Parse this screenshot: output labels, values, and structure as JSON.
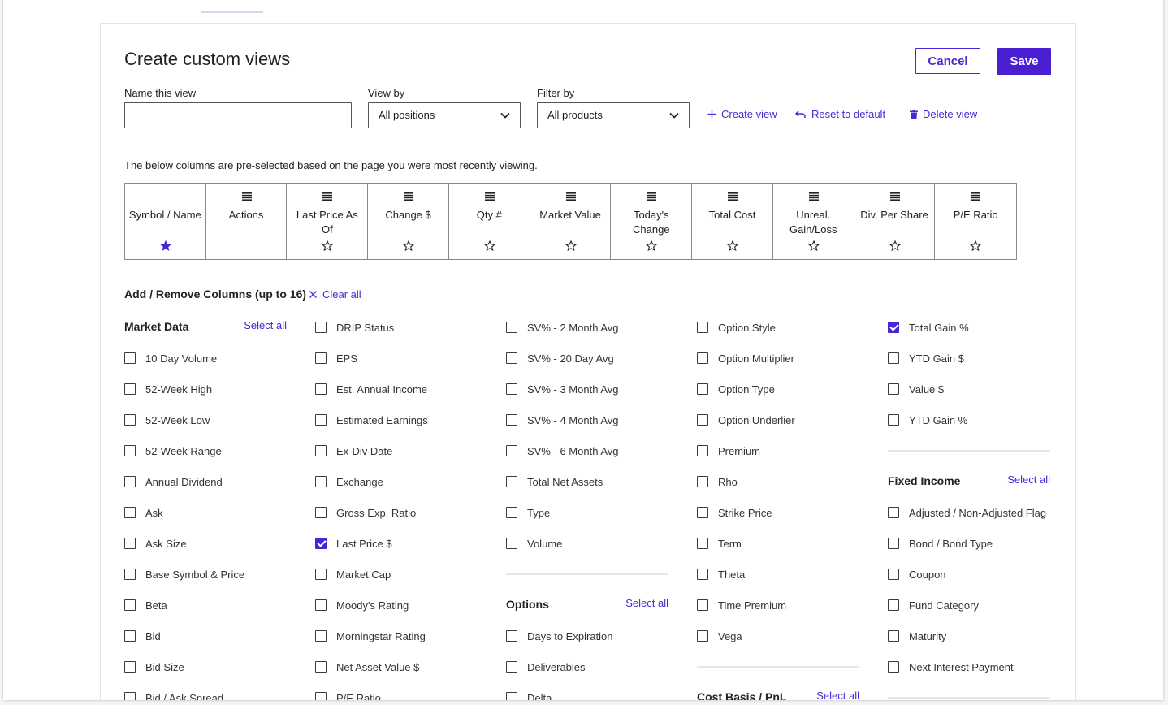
{
  "header": {
    "title": "Create custom views",
    "cancel_label": "Cancel",
    "save_label": "Save"
  },
  "form": {
    "name_label": "Name this view",
    "name_value": "",
    "viewby_label": "View by",
    "viewby_value": "All positions",
    "filterby_label": "Filter by",
    "filterby_value": "All products"
  },
  "actions": {
    "create": "Create view",
    "reset": "Reset to default",
    "delete": "Delete view"
  },
  "note": "The below columns are pre-selected based on the page you were most recently viewing.",
  "columns": [
    {
      "label": "Symbol / Name",
      "drag": false,
      "star": "filled"
    },
    {
      "label": "Actions",
      "drag": true,
      "star": "none"
    },
    {
      "label": "Last Price As Of",
      "drag": true,
      "star": "outline"
    },
    {
      "label": "Change $",
      "drag": true,
      "star": "outline"
    },
    {
      "label": "Qty #",
      "drag": true,
      "star": "outline"
    },
    {
      "label": "Market Value",
      "drag": true,
      "star": "outline"
    },
    {
      "label": "Today's Change",
      "drag": true,
      "star": "outline"
    },
    {
      "label": "Total Cost",
      "drag": true,
      "star": "outline"
    },
    {
      "label": "Unreal. Gain/Loss",
      "drag": true,
      "star": "outline"
    },
    {
      "label": "Div. Per Share",
      "drag": true,
      "star": "outline"
    },
    {
      "label": "P/E Ratio",
      "drag": true,
      "star": "outline"
    }
  ],
  "addremove": {
    "heading": "Add / Remove Columns (up to 16)",
    "clear_all": "Clear all"
  },
  "checklist_columns": [
    [
      {
        "group": "Market Data",
        "select_all": "Select all"
      },
      {
        "label": "10 Day Volume",
        "checked": false
      },
      {
        "label": "52-Week High",
        "checked": false
      },
      {
        "label": "52-Week Low",
        "checked": false
      },
      {
        "label": "52-Week Range",
        "checked": false
      },
      {
        "label": "Annual Dividend",
        "checked": false
      },
      {
        "label": "Ask",
        "checked": false
      },
      {
        "label": "Ask Size",
        "checked": false
      },
      {
        "label": "Base Symbol & Price",
        "checked": false
      },
      {
        "label": "Beta",
        "checked": false
      },
      {
        "label": "Bid",
        "checked": false
      },
      {
        "label": "Bid Size",
        "checked": false
      },
      {
        "label": "Bid / Ask Spread",
        "checked": false
      }
    ],
    [
      {
        "label": "DRIP Status",
        "checked": false
      },
      {
        "label": "EPS",
        "checked": false
      },
      {
        "label": "Est. Annual Income",
        "checked": false
      },
      {
        "label": "Estimated Earnings",
        "checked": false
      },
      {
        "label": "Ex-Div Date",
        "checked": false
      },
      {
        "label": "Exchange",
        "checked": false
      },
      {
        "label": "Gross Exp. Ratio",
        "checked": false
      },
      {
        "label": "Last Price $",
        "checked": true
      },
      {
        "label": "Market Cap",
        "checked": false
      },
      {
        "label": "Moody's Rating",
        "checked": false
      },
      {
        "label": "Morningstar Rating",
        "checked": false
      },
      {
        "label": "Net Asset Value $",
        "checked": false
      },
      {
        "label": "P/E Ratio",
        "checked": false
      }
    ],
    [
      {
        "label": "SV% - 2 Month Avg",
        "checked": false
      },
      {
        "label": "SV% - 20 Day Avg",
        "checked": false
      },
      {
        "label": "SV% - 3 Month Avg",
        "checked": false
      },
      {
        "label": "SV% - 4 Month Avg",
        "checked": false
      },
      {
        "label": "SV% - 6 Month Avg",
        "checked": false
      },
      {
        "label": "Total Net Assets",
        "checked": false
      },
      {
        "label": "Type",
        "checked": false
      },
      {
        "label": "Volume",
        "checked": false
      },
      {
        "divider": true
      },
      {
        "group": "Options",
        "select_all": "Select all"
      },
      {
        "label": "Days to Expiration",
        "checked": false
      },
      {
        "label": "Deliverables",
        "checked": false
      },
      {
        "label": "Delta",
        "checked": false
      }
    ],
    [
      {
        "label": "Option Style",
        "checked": false
      },
      {
        "label": "Option Multiplier",
        "checked": false
      },
      {
        "label": "Option Type",
        "checked": false
      },
      {
        "label": "Option Underlier",
        "checked": false
      },
      {
        "label": "Premium",
        "checked": false
      },
      {
        "label": "Rho",
        "checked": false
      },
      {
        "label": "Strike Price",
        "checked": false
      },
      {
        "label": "Term",
        "checked": false
      },
      {
        "label": "Theta",
        "checked": false
      },
      {
        "label": "Time Premium",
        "checked": false
      },
      {
        "label": "Vega",
        "checked": false
      },
      {
        "divider": true
      },
      {
        "group": "Cost Basis / PnL",
        "select_all": "Select all"
      }
    ],
    [
      {
        "label": "Total Gain %",
        "checked": true
      },
      {
        "label": "YTD Gain $",
        "checked": false
      },
      {
        "label": "Value $",
        "checked": false
      },
      {
        "label": "YTD Gain %",
        "checked": false
      },
      {
        "divider": true
      },
      {
        "group": "Fixed Income",
        "select_all": "Select all"
      },
      {
        "label": "Adjusted / Non-Adjusted Flag",
        "checked": false
      },
      {
        "label": "Bond / Bond Type",
        "checked": false
      },
      {
        "label": "Coupon",
        "checked": false
      },
      {
        "label": "Fund Category",
        "checked": false
      },
      {
        "label": "Maturity",
        "checked": false
      },
      {
        "label": "Next Interest Payment",
        "checked": false
      },
      {
        "divider": true
      }
    ]
  ],
  "colors": {
    "accent": "#4a25d6",
    "border": "#8a8a8a"
  }
}
